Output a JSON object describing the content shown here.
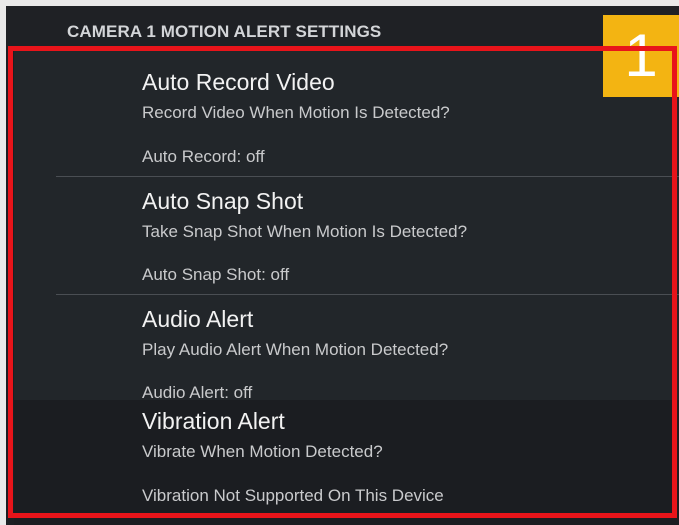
{
  "header": {
    "title": "CAMERA 1 MOTION ALERT SETTINGS"
  },
  "badge": {
    "label": "1",
    "color": "#f3b412"
  },
  "highlight": {
    "color": "#e8141a"
  },
  "settings": [
    {
      "title": "Auto Record Video",
      "subtitle": "Record Video When Motion Is Detected?",
      "status": "Auto Record: off"
    },
    {
      "title": "Auto Snap Shot",
      "subtitle": "Take Snap Shot When Motion Is Detected?",
      "status": "Auto Snap Shot: off"
    },
    {
      "title": "Audio Alert",
      "subtitle": "Play Audio Alert When Motion Detected?",
      "status": "Audio Alert: off"
    },
    {
      "title": "Vibration Alert",
      "subtitle": "Vibrate When Motion Detected?",
      "status": "Vibration Not Supported On This Device"
    }
  ]
}
